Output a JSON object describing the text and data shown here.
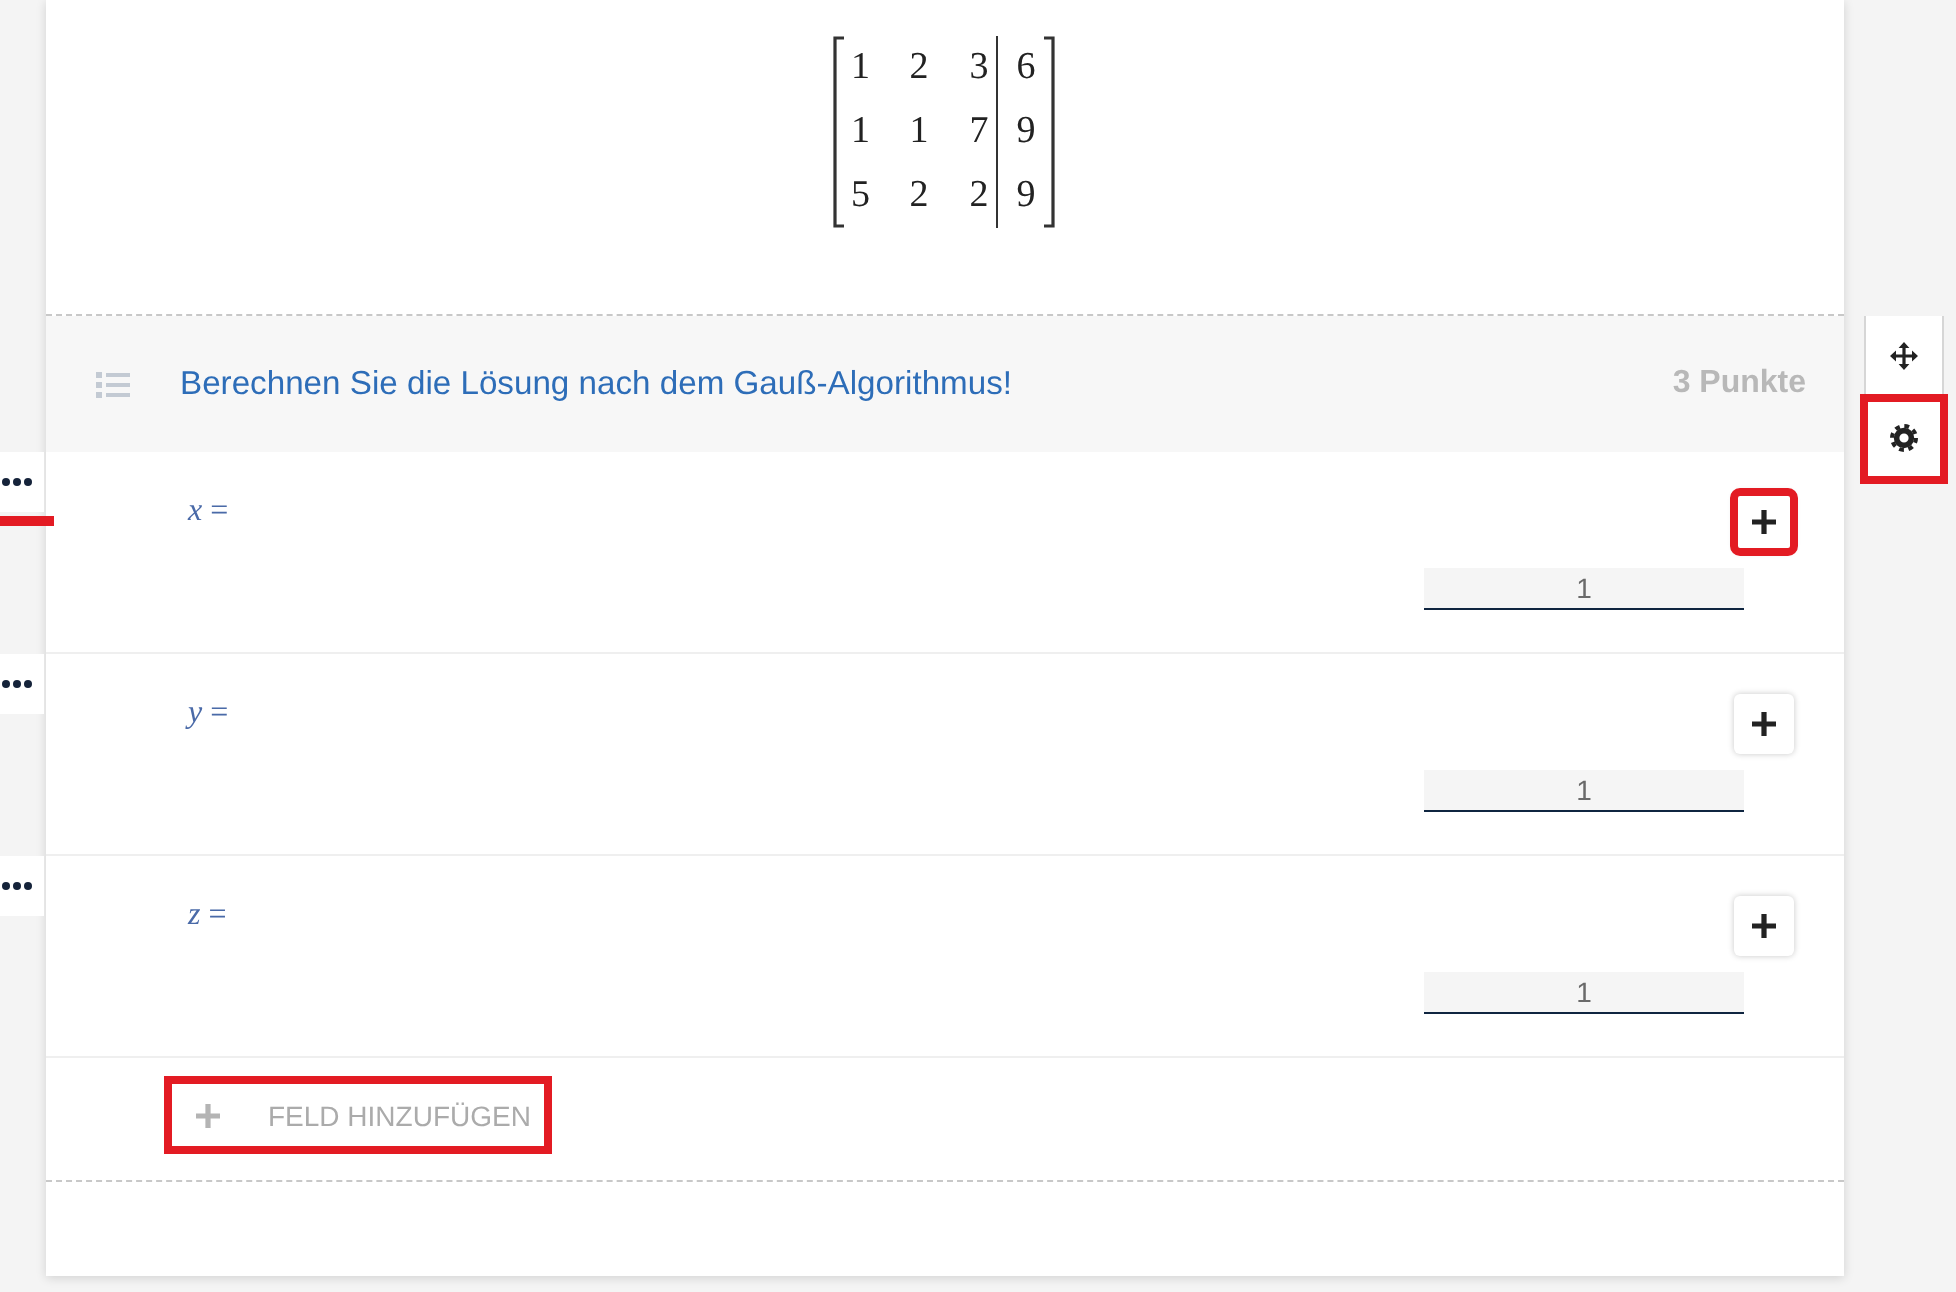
{
  "matrix": {
    "rows": [
      [
        "1",
        "2",
        "3",
        "6"
      ],
      [
        "1",
        "1",
        "7",
        "9"
      ],
      [
        "5",
        "2",
        "2",
        "9"
      ]
    ]
  },
  "task": {
    "title": "Berechnen Sie die Lösung nach dem Gauß-Algorithmus!",
    "points": "3 Punkte"
  },
  "fields": [
    {
      "label": "*x* =",
      "value": "1",
      "highlighted": true,
      "marked": true
    },
    {
      "label": "*y* =",
      "value": "1",
      "highlighted": false,
      "marked": false
    },
    {
      "label": "*z* =",
      "value": "1",
      "highlighted": false,
      "marked": false
    }
  ],
  "add_field": {
    "label": "FELD HINZUFÜGEN",
    "highlighted": true
  },
  "toolbar": [
    {
      "kind": "move",
      "highlighted": false
    },
    {
      "kind": "settings",
      "highlighted": true
    }
  ]
}
